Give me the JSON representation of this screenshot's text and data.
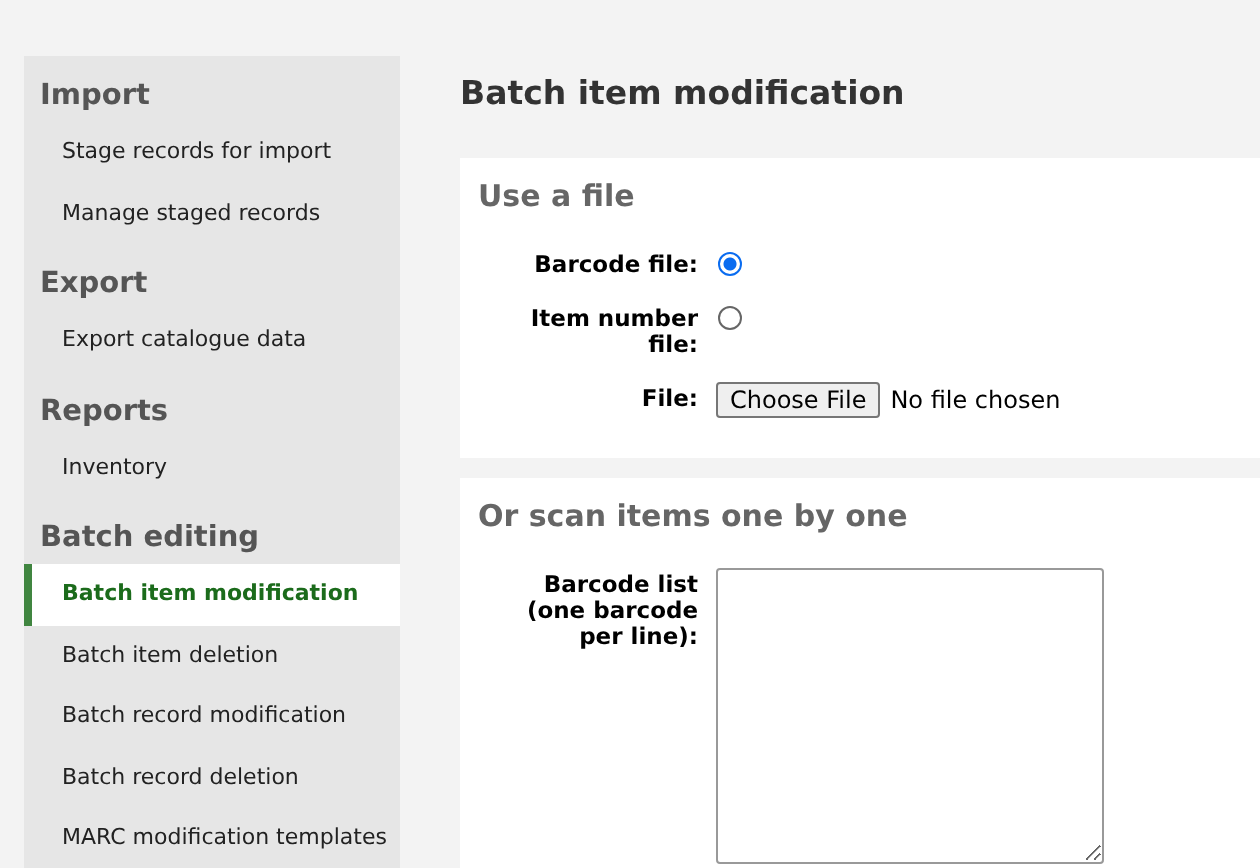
{
  "sidebar": {
    "sections": [
      {
        "heading": "Import",
        "items": [
          {
            "label": "Stage records for import",
            "selected": false
          },
          {
            "label": "Manage staged records",
            "selected": false
          }
        ]
      },
      {
        "heading": "Export",
        "items": [
          {
            "label": "Export catalogue data",
            "selected": false
          }
        ]
      },
      {
        "heading": "Reports",
        "items": [
          {
            "label": "Inventory",
            "selected": false
          }
        ]
      },
      {
        "heading": "Batch editing",
        "items": [
          {
            "label": "Batch item modification",
            "selected": true
          },
          {
            "label": "Batch item deletion",
            "selected": false
          },
          {
            "label": "Batch record modification",
            "selected": false
          },
          {
            "label": "Batch record deletion",
            "selected": false
          },
          {
            "label": "MARC modification templates",
            "selected": false
          }
        ]
      }
    ]
  },
  "page_title": "Batch item modification",
  "panels": [
    {
      "title": "Use a file",
      "fields": [
        {
          "kind": "radio",
          "label": "Barcode file:",
          "selected": true
        },
        {
          "kind": "radio",
          "label": "Item number file:",
          "selected": false
        },
        {
          "kind": "file",
          "label": "File:",
          "button": "Choose File",
          "status": "No file chosen"
        }
      ]
    },
    {
      "title": "Or scan items one by one",
      "fields": [
        {
          "kind": "textarea",
          "label": "Barcode list (one barcode per line):"
        }
      ]
    }
  ]
}
